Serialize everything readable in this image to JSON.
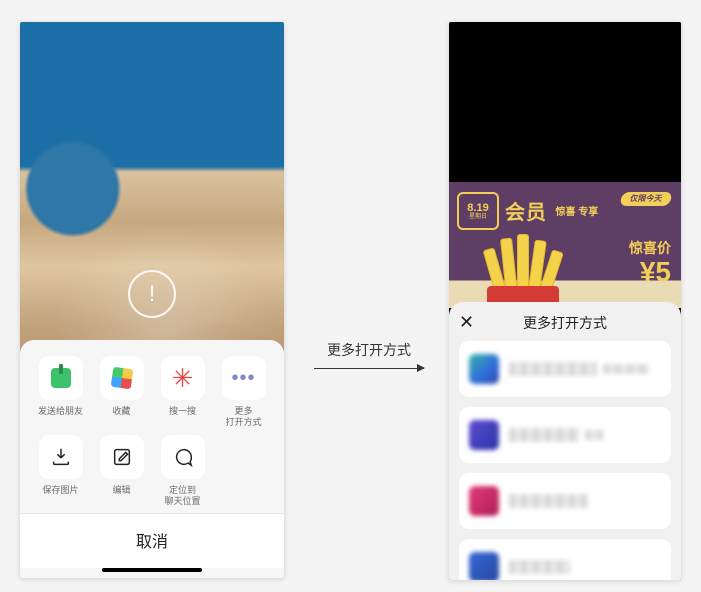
{
  "arrow_label": "更多打开方式",
  "left": {
    "center_icon_char": "!",
    "actions_row1": [
      {
        "id": "send-friend",
        "label": "发送给朋友",
        "icon": "forward-icon"
      },
      {
        "id": "favorite",
        "label": "收藏",
        "icon": "favorite-cube-icon"
      },
      {
        "id": "scan",
        "label": "搜一搜",
        "icon": "sparkle-icon"
      },
      {
        "id": "open-more",
        "label": "更多\n打开方式",
        "icon": "ellipsis-icon"
      }
    ],
    "actions_row2": [
      {
        "id": "save-image",
        "label": "保存图片",
        "icon": "download-icon"
      },
      {
        "id": "edit",
        "label": "编辑",
        "icon": "edit-icon"
      },
      {
        "id": "locate-chat",
        "label": "定位到\n聊天位置",
        "icon": "chat-bubble-icon"
      }
    ],
    "cancel_label": "取消"
  },
  "right": {
    "banner": {
      "badge_top": "8.19",
      "badge_bottom": "星期日",
      "member_text": "会员",
      "member_small": "惊喜\n专享",
      "tag_text": "仅限今天",
      "price_label": "惊喜价",
      "price_value": "¥5"
    },
    "sheet_title": "更多打开方式",
    "apps": [
      {
        "id": "app-1",
        "icon": "app-icon-1"
      },
      {
        "id": "app-2",
        "icon": "app-icon-2"
      },
      {
        "id": "app-3",
        "icon": "app-icon-3"
      },
      {
        "id": "app-4",
        "icon": "app-icon-4"
      }
    ]
  }
}
